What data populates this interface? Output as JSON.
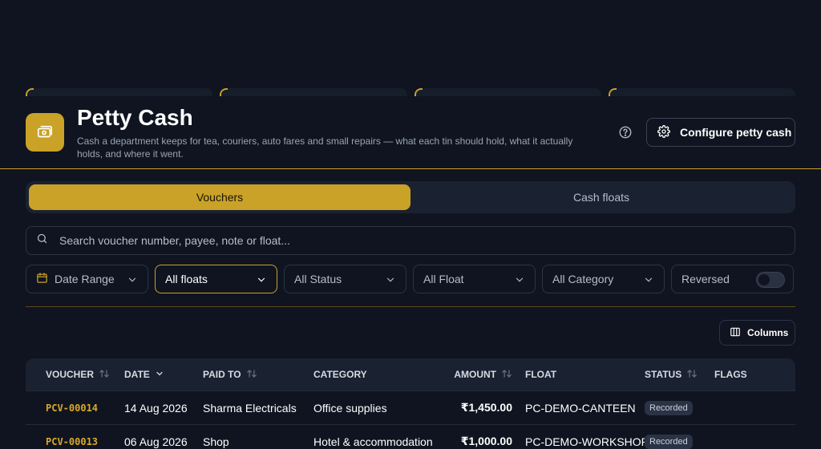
{
  "header": {
    "title": "Petty Cash",
    "subtitle": "Cash a department keeps for tea, couriers, auto fares and small repairs — what each tin should hold, what it actually holds, and where it went.",
    "configure_label": "Configure petty cash"
  },
  "tabs": {
    "active": "Vouchers",
    "inactive": "Cash floats"
  },
  "search": {
    "placeholder": "Search voucher number, payee, note or float..."
  },
  "filters": {
    "date_range": "Date Range",
    "floats": "All floats",
    "status": "All Status",
    "float": "All Float",
    "category": "All Category",
    "reversed": "Reversed"
  },
  "columns_label": "Columns",
  "table": {
    "headers": {
      "voucher": "VOUCHER",
      "date": "DATE",
      "paid_to": "PAID TO",
      "category": "CATEGORY",
      "amount": "AMOUNT",
      "float": "FLOAT",
      "status": "STATUS",
      "flags": "FLAGS"
    },
    "rows": [
      {
        "voucher": "PCV-00014",
        "date": "14 Aug 2026",
        "paid_to": "Sharma Electricals",
        "category": "Office supplies",
        "amount": "₹1,450.00",
        "float": "PC-DEMO-CANTEEN",
        "status": "Recorded"
      },
      {
        "voucher": "PCV-00013",
        "date": "06 Aug 2026",
        "paid_to": "Shop",
        "category": "Hotel & accommodation",
        "amount": "₹1,000.00",
        "float": "PC-DEMO-WORKSHOP",
        "status": "Recorded"
      }
    ]
  },
  "colors": {
    "accent": "#c9a227",
    "background": "#0f1420",
    "voucher_text": "#d9a928"
  },
  "icons": [
    "money-tin-icon",
    "help-icon",
    "gear-icon",
    "search-icon",
    "calendar-icon",
    "chevron-down-icon",
    "columns-icon",
    "sort-icon"
  ]
}
